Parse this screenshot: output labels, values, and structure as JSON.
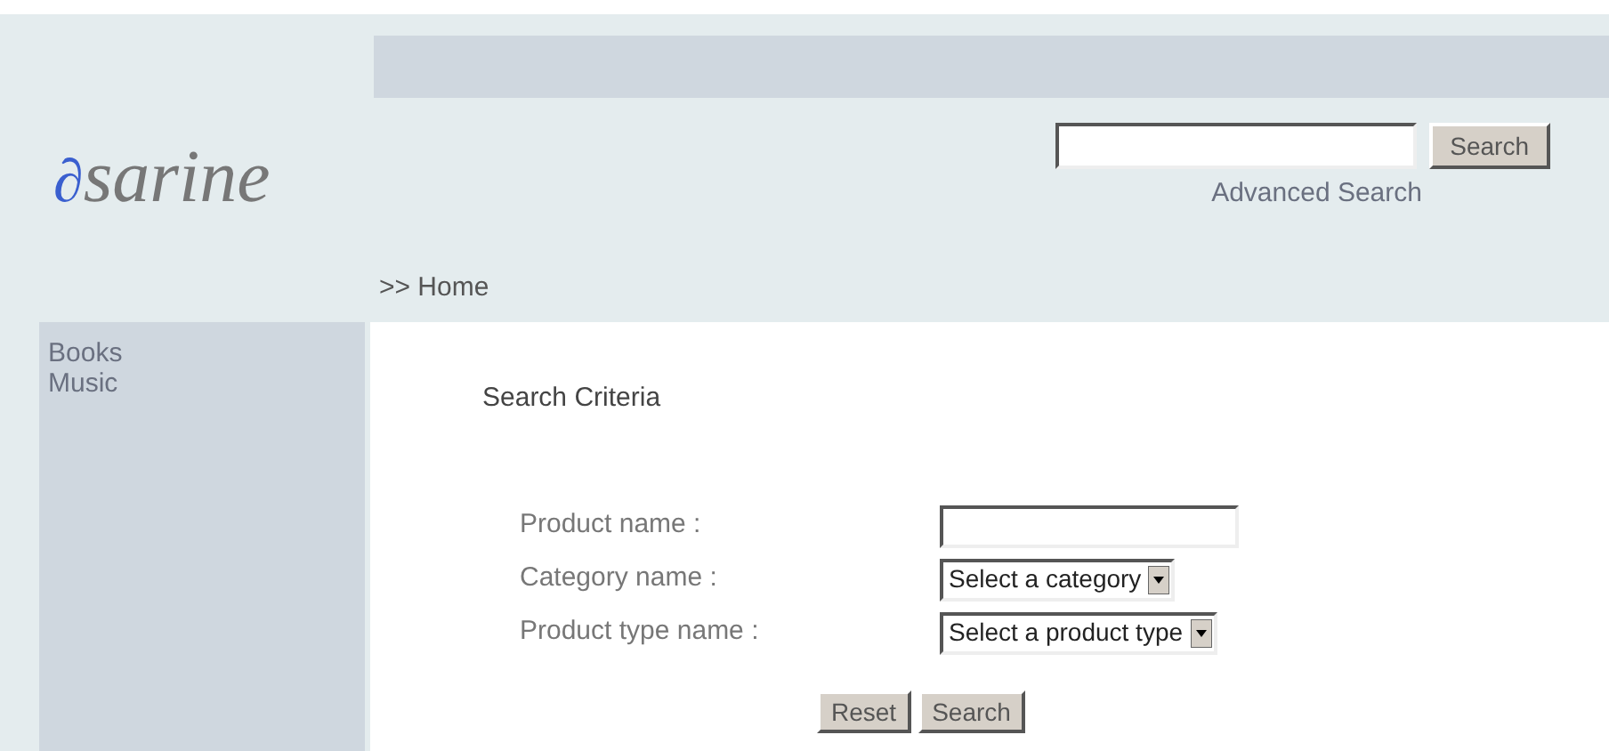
{
  "logo": {
    "mark": "∂",
    "text": "sarine"
  },
  "header_search": {
    "button": "Search",
    "link": "Advanced Search"
  },
  "breadcrumb": ">> Home",
  "sidebar": {
    "items": [
      {
        "label": "Books"
      },
      {
        "label": "Music"
      }
    ]
  },
  "search_form": {
    "title": "Search Criteria",
    "fields": [
      {
        "kind": "text",
        "label": "Product name :"
      },
      {
        "kind": "select",
        "label": "Category name :",
        "value": "Select a category"
      },
      {
        "kind": "select",
        "label": "Product type name :",
        "value": "Select a product type"
      }
    ],
    "buttons": [
      "Reset",
      "Search"
    ]
  }
}
